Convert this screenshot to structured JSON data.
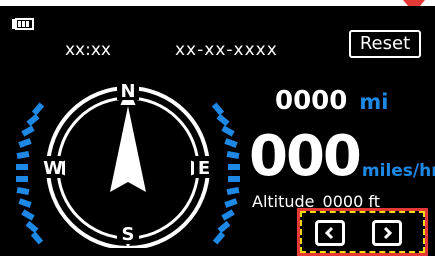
{
  "status": {
    "battery_icon": "battery-full-icon",
    "time": "xx:xx",
    "date": "xx-xx-xxxx"
  },
  "toolbar": {
    "reset_label": "Reset"
  },
  "compass": {
    "north": "N",
    "south": "S",
    "east": "E",
    "west": "W",
    "needle_icon": "compass-needle-icon",
    "accent_color": "#1e88e5"
  },
  "distance": {
    "value": "0000",
    "unit": "mi"
  },
  "speed": {
    "value": "000",
    "unit": "miles/hr"
  },
  "altitude": {
    "label": "Altitude",
    "value": "0000 ft"
  },
  "navigation": {
    "prev_icon": "chevron-left-icon",
    "next_icon": "chevron-right-icon",
    "highlight_color": "#e53935",
    "dash_color": "#f6d90b"
  }
}
